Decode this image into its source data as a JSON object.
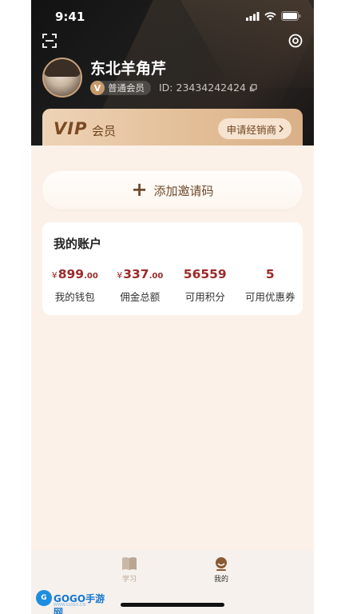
{
  "status_bar": {
    "time": "9:41"
  },
  "profile": {
    "name": "东北羊角芹",
    "level": "普通会员",
    "id_text": "ID: 23434242424"
  },
  "vip": {
    "logo": "VIP",
    "label": "会员",
    "dealer_button": "申请经销商"
  },
  "invite": {
    "label": "添加邀请码"
  },
  "account": {
    "title": "我的账户",
    "stats": [
      {
        "currency": "¥",
        "int": "899",
        "dec": ".00",
        "label": "我的钱包"
      },
      {
        "currency": "¥",
        "int": "337",
        "dec": ".00",
        "label": "佣金总额"
      },
      {
        "currency": "",
        "int": "56559",
        "dec": "",
        "label": "可用积分"
      },
      {
        "currency": "",
        "int": "5",
        "dec": "",
        "label": "可用优惠券"
      }
    ]
  },
  "tabs": [
    {
      "label": "学习",
      "icon": "book-icon",
      "active": false
    },
    {
      "label": "我的",
      "icon": "profile-icon",
      "active": true
    }
  ],
  "watermark": {
    "logo": "G",
    "text": "GOGO手游网",
    "sub": "WWW.GOGO.CN"
  },
  "colors": {
    "accent": "#9c2a2a",
    "vip_gold": "#e3bf98",
    "brown": "#6f4a2a"
  }
}
